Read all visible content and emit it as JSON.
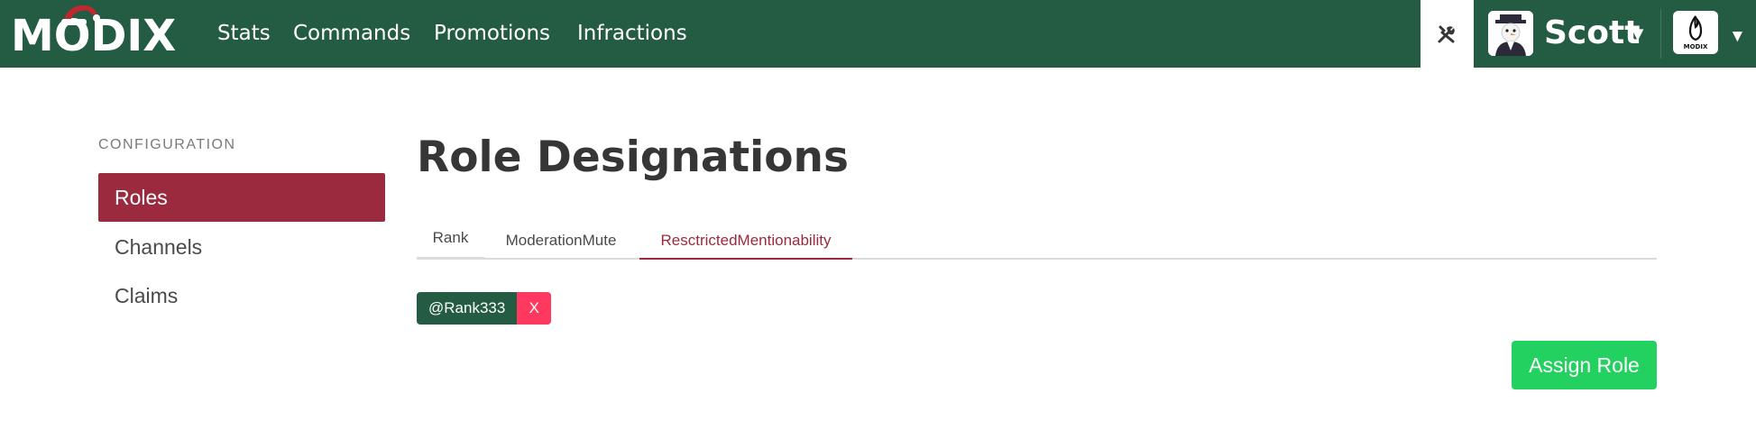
{
  "brand": {
    "logo_text": "MODIX",
    "server_logo_text": "MODIX"
  },
  "nav": {
    "items": [
      {
        "label": "Stats"
      },
      {
        "label": "Commands"
      },
      {
        "label": "Promotions"
      },
      {
        "label": "Infractions"
      }
    ]
  },
  "user": {
    "name": "Scott",
    "caret": "▼"
  },
  "server": {
    "caret": "▼"
  },
  "sidebar": {
    "section_label": "CONFIGURATION",
    "items": [
      {
        "label": "Roles",
        "active": true
      },
      {
        "label": "Channels",
        "active": false
      },
      {
        "label": "Claims",
        "active": false
      }
    ]
  },
  "page": {
    "title": "Role Designations"
  },
  "tabs": [
    {
      "label": "Rank",
      "active": false
    },
    {
      "label": "ModerationMute",
      "active": false
    },
    {
      "label": "ResctrictedMentionability",
      "active": true
    }
  ],
  "roles": [
    {
      "name": "@Rank333",
      "remove_label": "X"
    }
  ],
  "actions": {
    "assign_label": "Assign Role"
  },
  "colors": {
    "navbar": "#245b43",
    "active_menu": "#9b2a3f",
    "tag": "#245b43",
    "delete": "#ff3860",
    "primary_button": "#23d160"
  }
}
